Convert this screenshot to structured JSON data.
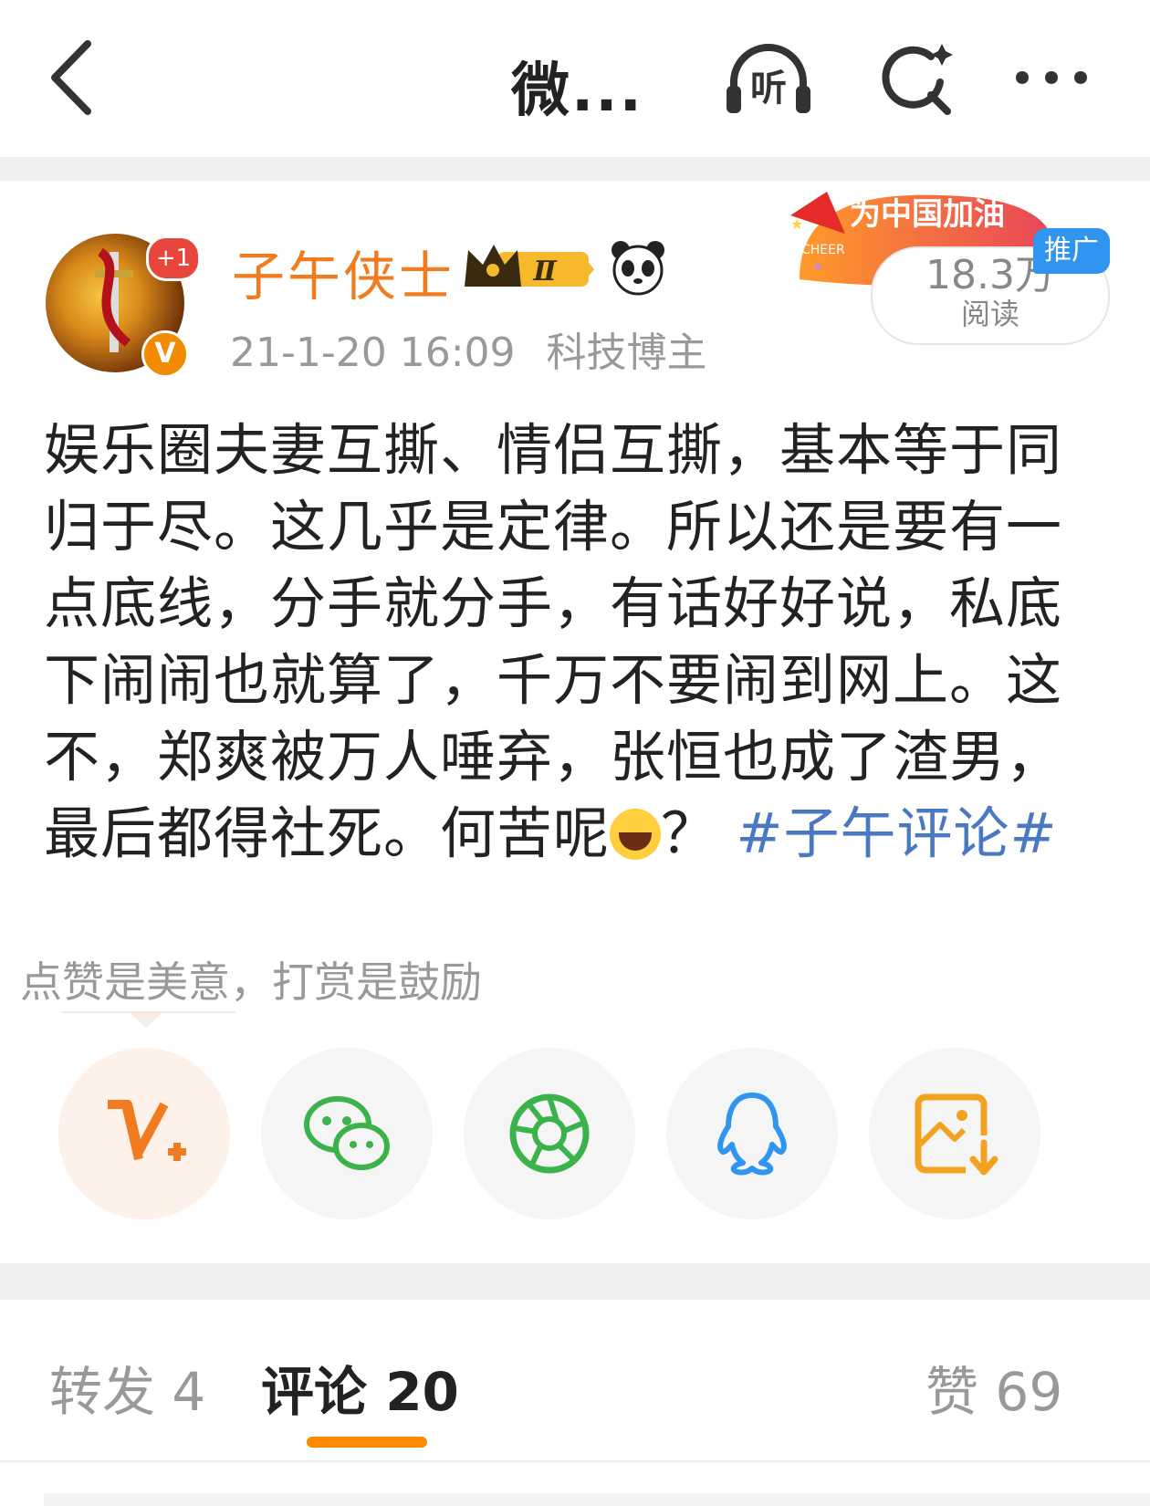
{
  "header": {
    "title": "微...",
    "listen_label": "听"
  },
  "author": {
    "name": "子午侠士",
    "avatar_badge": "+1",
    "verified_mark": "V",
    "level_badge": "Ⅱ",
    "timestamp": "21-1-20 16:09",
    "category": "科技博主"
  },
  "promo": {
    "banner_text": "为中国加油",
    "banner_sub": "CHEER",
    "tag": "推广",
    "reads_value": "18.3万",
    "reads_label": "阅读"
  },
  "post": {
    "text": "娱乐圈夫妻互撕、情侣互撕，基本等于同归于尽。这几乎是定律。所以还是要有一点底线，分手就分手，有话好好说，私底下闹闹也就算了，千万不要闹到网上。这不，郑爽被万人唾弃，张恒也成了渣男，最后都得社死。何苦呢",
    "after_emoji": "？",
    "hashtag": "#子午评论#"
  },
  "reward": {
    "hint": "点赞是美意，打赏是鼓励"
  },
  "share_targets": [
    {
      "icon": "v-plus-icon"
    },
    {
      "icon": "wechat-icon"
    },
    {
      "icon": "moments-icon"
    },
    {
      "icon": "qq-icon"
    },
    {
      "icon": "save-image-icon"
    }
  ],
  "colors": {
    "accent_orange": "#f27a1f",
    "hashtag_blue": "#4a78c2",
    "wechat_green": "#3bb34a",
    "qq_blue": "#2f95f0",
    "tab_underline": "#ff8a00"
  },
  "tabs": {
    "repost": "转发 4",
    "comments": "评论 20",
    "likes": "赞 69"
  }
}
